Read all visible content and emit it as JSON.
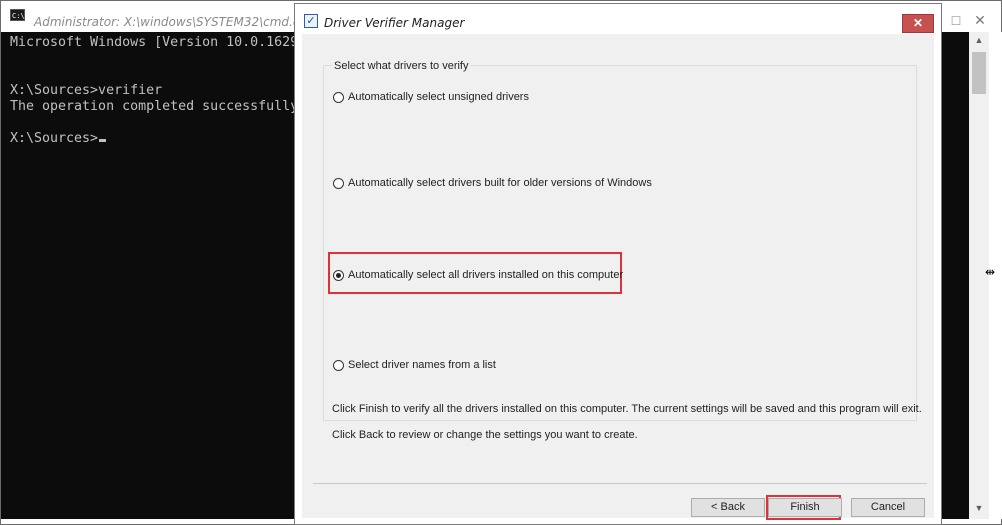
{
  "cmd": {
    "title": "Administrator: X:\\windows\\SYSTEM32\\cmd.exe",
    "icon_text": "C:\\.",
    "lines": [
      "Microsoft Windows [Version 10.0.1629",
      "",
      "X:\\Sources>verifier",
      "The operation completed successfully",
      "",
      "X:\\Sources>"
    ],
    "caption_buttons": {
      "minimize": "–",
      "maximize": "□",
      "close": "✕"
    },
    "scroll_up": "▲",
    "scroll_down": "▼"
  },
  "dialog": {
    "title": "Driver Verifier Manager",
    "close_label": "✕",
    "group_label": "Select what drivers to verify",
    "options": [
      {
        "label": "Automatically select unsigned drivers",
        "checked": false
      },
      {
        "label": "Automatically select drivers built for older versions of Windows",
        "checked": false
      },
      {
        "label": "Automatically select all drivers installed on this computer",
        "checked": true
      },
      {
        "label": "Select driver names from a list",
        "checked": false
      }
    ],
    "info_1": "Click Finish to verify all the drivers installed on this computer. The current settings will be saved and this program will exit.",
    "info_2": "Click Back to review or change the settings you want to create.",
    "buttons": {
      "back": "< Back",
      "finish": "Finish",
      "cancel": "Cancel"
    },
    "highlight_color": "#e0313a"
  }
}
